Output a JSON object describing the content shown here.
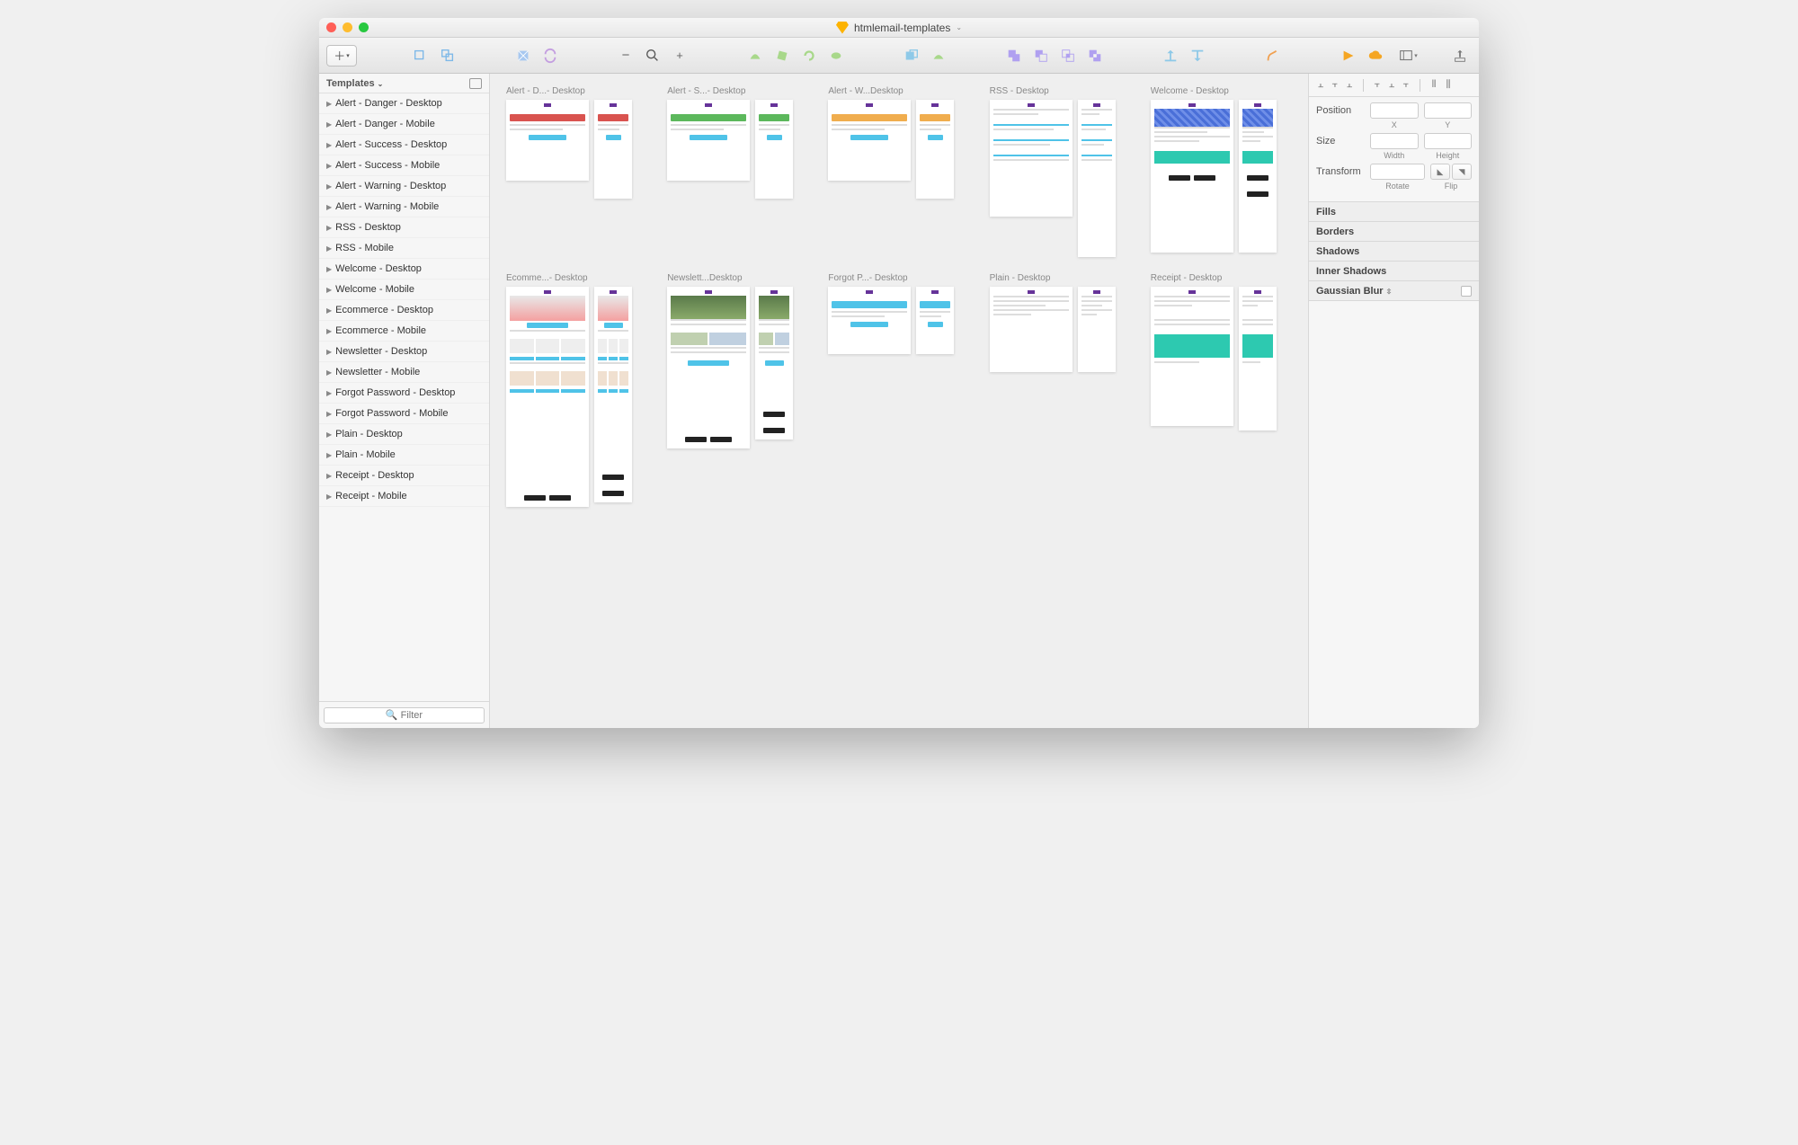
{
  "window": {
    "title": "htmlemail-templates"
  },
  "sidebar": {
    "header": "Templates",
    "items": [
      "Alert - Danger - Desktop",
      "Alert - Danger - Mobile",
      "Alert - Success - Desktop",
      "Alert - Success - Mobile",
      "Alert - Warning - Desktop",
      "Alert - Warning - Mobile",
      "RSS - Desktop",
      "RSS - Mobile",
      "Welcome - Desktop",
      "Welcome - Mobile",
      "Ecommerce - Desktop",
      "Ecommerce - Mobile",
      "Newsletter - Desktop",
      "Newsletter - Mobile",
      "Forgot Password - Desktop",
      "Forgot Password - Mobile",
      "Plain - Desktop",
      "Plain - Mobile",
      "Receipt - Desktop",
      "Receipt - Mobile"
    ],
    "filter_placeholder": "Filter"
  },
  "canvas": {
    "artboards": [
      {
        "label": "Alert - D...- Desktop",
        "color": "#d9534f",
        "h_desktop": 90,
        "h_mobile": 110
      },
      {
        "label": "Alert - S...- Desktop",
        "color": "#5cb85c",
        "h_desktop": 90,
        "h_mobile": 110
      },
      {
        "label": "Alert - W...Desktop",
        "color": "#f0ad4e",
        "h_desktop": 90,
        "h_mobile": 110
      },
      {
        "label": "RSS - Desktop",
        "color": "#4fc3e8",
        "h_desktop": 130,
        "h_mobile": 175,
        "kind": "rss"
      },
      {
        "label": "Welcome - Desktop",
        "color": "#2dc9b0",
        "h_desktop": 170,
        "h_mobile": 170,
        "kind": "welcome"
      },
      {
        "label": "Ecomme...- Desktop",
        "color": "#4fc3e8",
        "h_desktop": 245,
        "h_mobile": 240,
        "kind": "ecom"
      },
      {
        "label": "Newslett...Desktop",
        "color": "#4fc3e8",
        "h_desktop": 180,
        "h_mobile": 170,
        "kind": "news"
      },
      {
        "label": "Forgot P...- Desktop",
        "color": "#4fc3e8",
        "h_desktop": 75,
        "h_mobile": 75
      },
      {
        "label": "Plain - Desktop",
        "color": "#4fc3e8",
        "h_desktop": 95,
        "h_mobile": 95,
        "kind": "plain"
      },
      {
        "label": "Receipt - Desktop",
        "color": "#2dc9b0",
        "h_desktop": 155,
        "h_mobile": 160,
        "kind": "receipt"
      }
    ]
  },
  "inspector": {
    "position_label": "Position",
    "x_label": "X",
    "y_label": "Y",
    "size_label": "Size",
    "width_label": "Width",
    "height_label": "Height",
    "transform_label": "Transform",
    "rotate_label": "Rotate",
    "flip_label": "Flip",
    "sections": {
      "fills": "Fills",
      "borders": "Borders",
      "shadows": "Shadows",
      "inner_shadows": "Inner Shadows",
      "gaussian_blur": "Gaussian Blur"
    }
  }
}
